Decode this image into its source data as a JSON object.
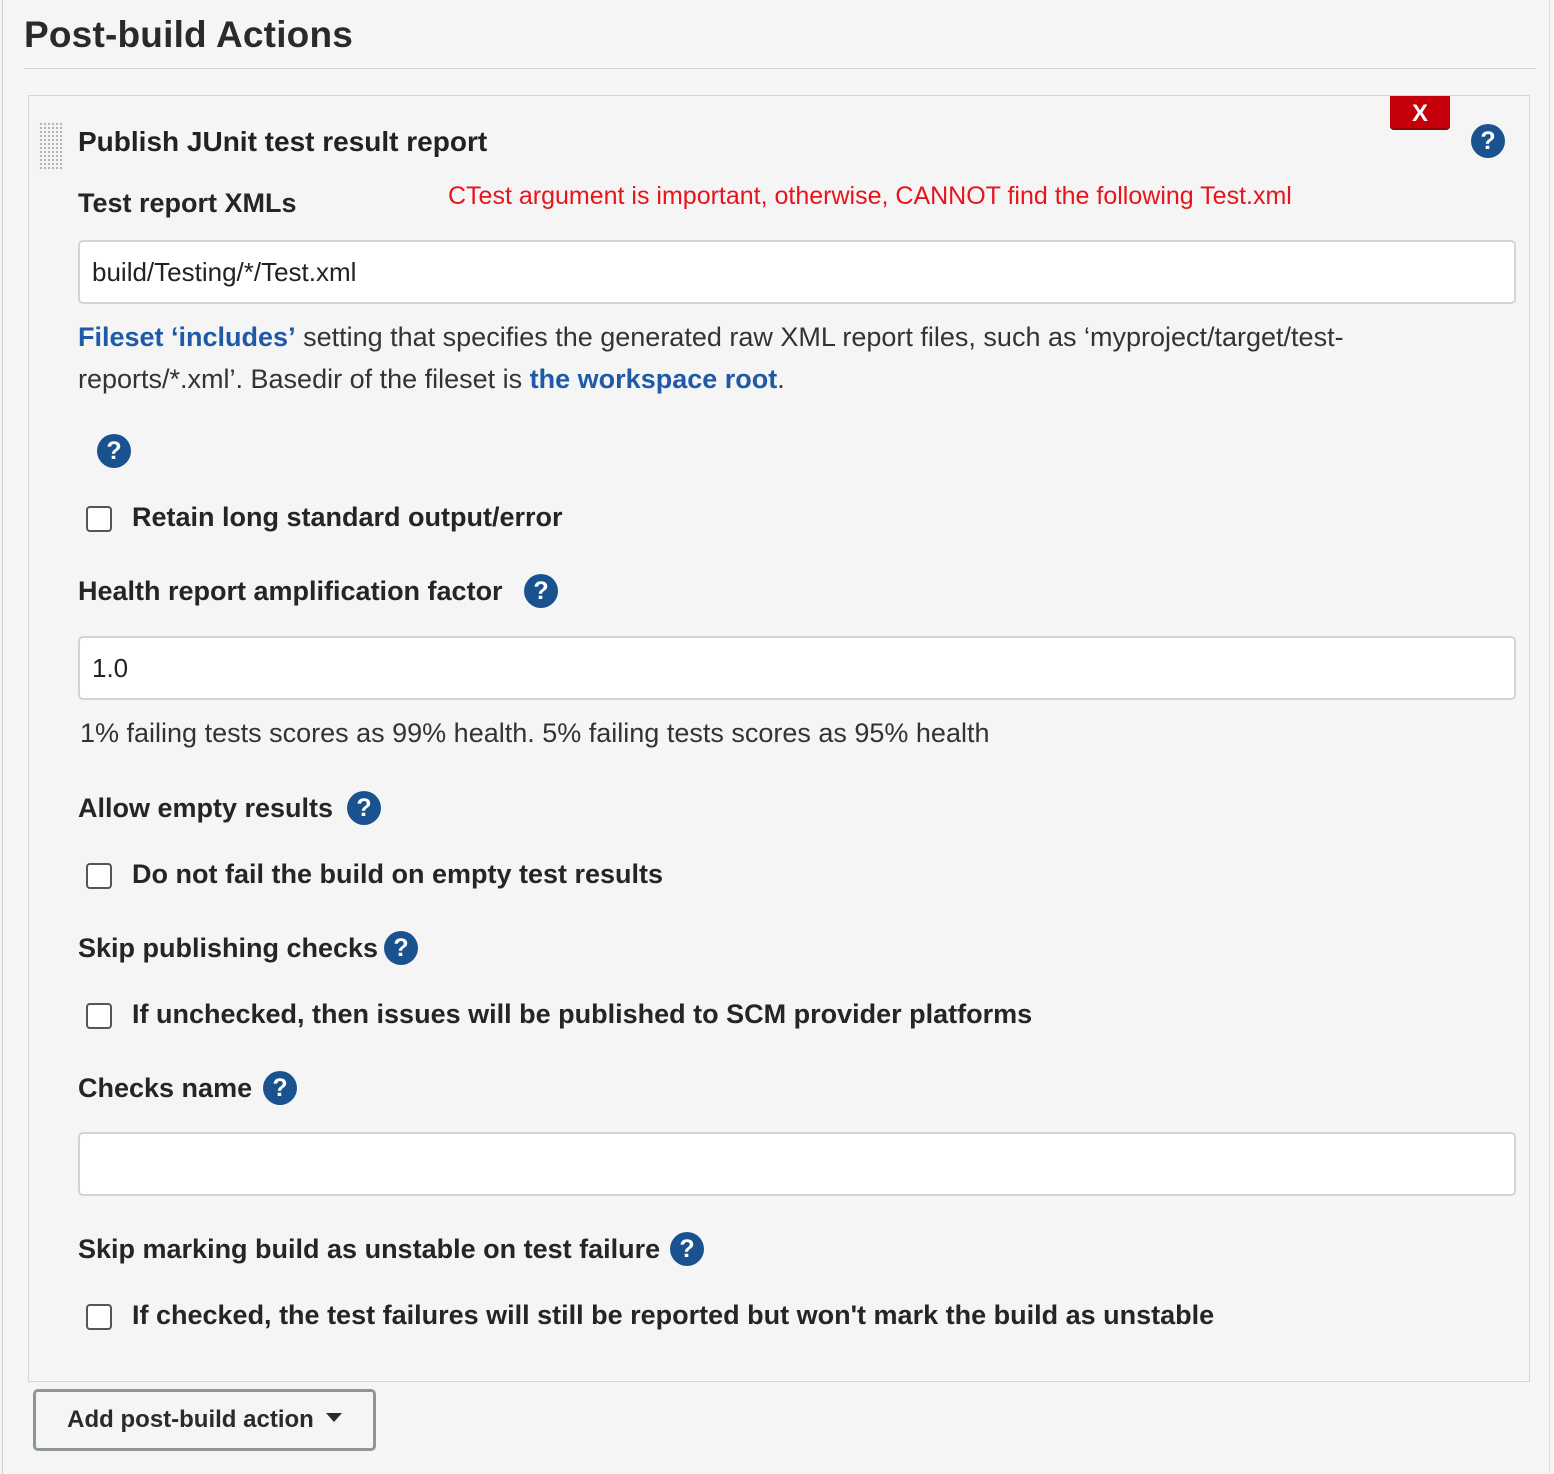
{
  "section": {
    "title": "Post-build Actions"
  },
  "publisher": {
    "title": "Publish JUnit test result report",
    "delete_label": "X",
    "help_glyph": "?"
  },
  "test_report": {
    "label": "Test report XMLs",
    "annotation": "CTest argument is important, otherwise, CANNOT find the following Test.xml",
    "value": "build/Testing/*/Test.xml",
    "description": {
      "link1": "Fileset ‘includes’",
      "text1": " setting that specifies the generated raw XML report files, such as ‘myproject/target/test-reports/*.xml’. Basedir of the fileset is ",
      "link2": "the workspace root",
      "text2": "."
    }
  },
  "retain_output": {
    "label": "Retain long standard output/error",
    "checked": false
  },
  "health_factor": {
    "label": "Health report amplification factor",
    "value": "1.0",
    "hint": "1% failing tests scores as 99% health. 5% failing tests scores as 95% health"
  },
  "allow_empty": {
    "label": "Allow empty results",
    "checkbox_label": "Do not fail the build on empty test results",
    "checked": false
  },
  "skip_checks": {
    "label": "Skip publishing checks",
    "checkbox_label": "If unchecked, then issues will be published to SCM provider platforms",
    "checked": false
  },
  "checks_name": {
    "label": "Checks name",
    "value": ""
  },
  "skip_unstable": {
    "label": "Skip marking build as unstable on test failure",
    "checkbox_label": "If checked, the test failures will still be reported but won't mark the build as unstable",
    "checked": false
  },
  "add_action": {
    "label": "Add post-build action"
  },
  "colors": {
    "help_icon": "#1a5290",
    "delete_button": "#c4000a",
    "annotation": "#e8141c",
    "link": "#1e5aa6"
  },
  "icons": {
    "help": "question-circle-icon",
    "drag": "drag-handle-icon",
    "dropdown": "caret-down-icon"
  }
}
